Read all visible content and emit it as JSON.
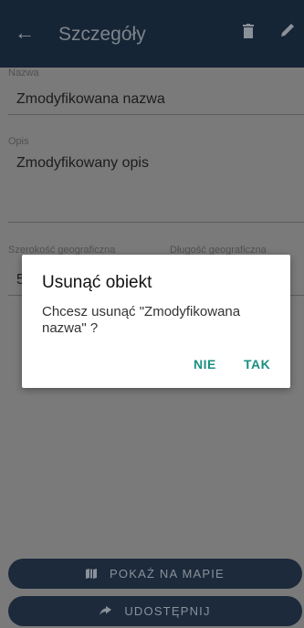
{
  "appbar": {
    "back_icon": "arrow-left-icon",
    "title": "Szczegóły",
    "delete_icon": "trash-icon",
    "edit_icon": "pencil-icon"
  },
  "form": {
    "name_label": "Nazwa",
    "name_value": "Zmodyfikowana nazwa",
    "desc_label": "Opis",
    "desc_value": "Zmodyfikowany opis",
    "lat_label": "Szerokość geograficzna",
    "lon_label": "Długość geograficzna",
    "lat_value_partial": "5"
  },
  "dialog": {
    "title": "Usunąć obiekt",
    "message": "Chcesz usunąć \"Zmodyfikowana nazwa\" ?",
    "no_label": "NIE",
    "yes_label": "TAK"
  },
  "buttons": {
    "map_label": "POKAŻ NA MAPIE",
    "map_icon": "map-icon",
    "share_label": "UDOSTĘPNIJ",
    "share_icon": "share-icon"
  },
  "colors": {
    "appbar": "#162536",
    "accent": "#1a8f80",
    "button": "#1c2a3b"
  }
}
